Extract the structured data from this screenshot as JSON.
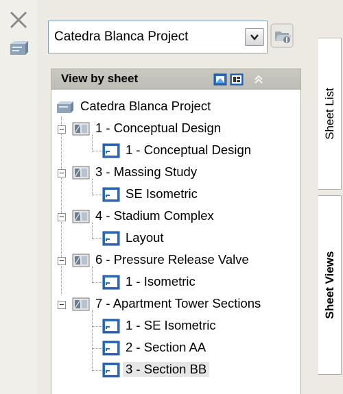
{
  "project_selector": {
    "value": "Catedra Blanca Project"
  },
  "panel": {
    "title": "View by sheet"
  },
  "tree": {
    "root": "Catedra Blanca Project",
    "sheets": [
      {
        "label": "1 - Conceptual Design",
        "views": [
          "1 - Conceptual Design"
        ]
      },
      {
        "label": "3 - Massing Study",
        "views": [
          "SE Isometric"
        ]
      },
      {
        "label": "4 - Stadium Complex",
        "views": [
          "Layout"
        ]
      },
      {
        "label": "6 - Pressure Release Valve",
        "views": [
          "1 - Isometric"
        ]
      },
      {
        "label": "7 - Apartment Tower Sections",
        "views": [
          "1 - SE Isometric",
          "2 - Section AA",
          "3 - Section BB"
        ]
      }
    ],
    "selected": "3 - Section BB"
  },
  "tabs": [
    {
      "label": "Sheet List",
      "active": false
    },
    {
      "label": "Sheet Views",
      "active": true
    }
  ],
  "colors": {
    "panel_bg": "#eceae3",
    "header_bg": "#c5c4bd",
    "selection_bg": "#e6e6e6",
    "icon_blue": "#2a6cc0"
  },
  "icons": {
    "close": "close-icon",
    "properties": "properties-icon",
    "dropdown": "chevron-down-icon",
    "open": "open-project-icon",
    "header_new_view": "new-view-icon",
    "header_place": "place-view-icon",
    "collapse": "chevron-up-icon"
  }
}
